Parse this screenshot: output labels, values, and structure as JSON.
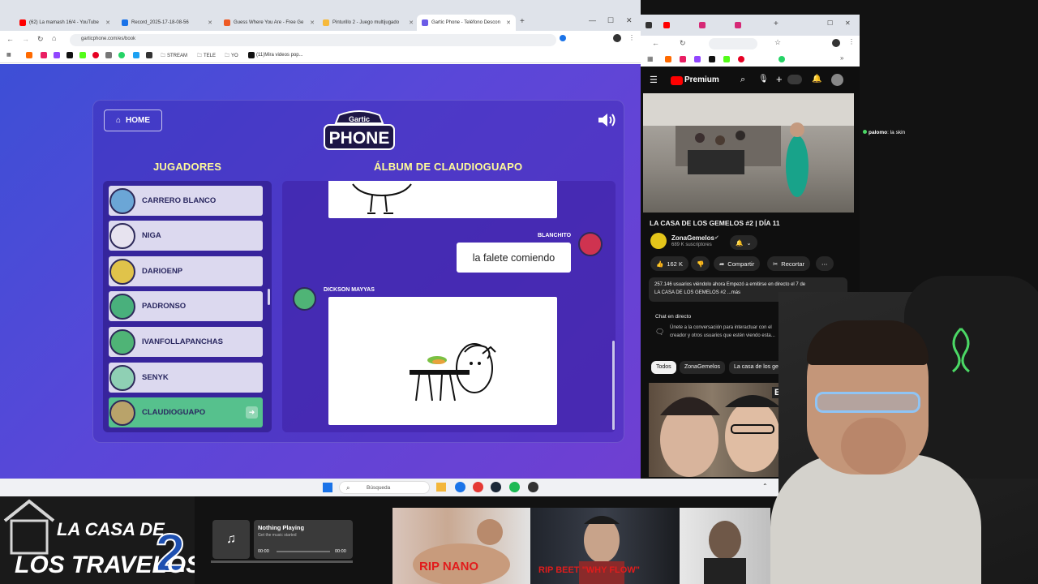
{
  "left_browser": {
    "tabs": [
      {
        "label": "(62) La mamash 16/4 - YouTube",
        "color": "#ff0000"
      },
      {
        "label": "Record_2025-17-18-08-56",
        "color": "#1a73e8"
      },
      {
        "label": "Guess Where You Are - Free Ge",
        "color": "#ee5a24"
      },
      {
        "label": "Pinturillo 2 - Juego multijugado",
        "color": "#f6b93b"
      },
      {
        "label": "Gartic Phone - Teléfono Descon",
        "color": "#6c5ce7"
      }
    ],
    "url": "garticphone.com/es/book",
    "bookmarks": [
      "STREAM",
      "TELE",
      "YO",
      "(11)Mira videos pop..."
    ]
  },
  "game": {
    "home_label": "HOME",
    "logo_top": "Gartic",
    "logo_bottom": "PHONE",
    "players_title": "JUGADORES",
    "album_title": "ÁLBUM DE CLAUDIOGUAPO",
    "players": [
      {
        "name": "CARRERO BLANCO",
        "color": "#6ba6d6"
      },
      {
        "name": "NIGA",
        "color": "#e7e3ef"
      },
      {
        "name": "DARIOENP",
        "color": "#e0c34a"
      },
      {
        "name": "PADRONSO",
        "color": "#49b07c"
      },
      {
        "name": "IVANFOLLAPANCHAS",
        "color": "#4fb476"
      },
      {
        "name": "SENYK",
        "color": "#8fd0b4"
      },
      {
        "name": "CLAUDIOGUAPO",
        "color": "#b9a36a"
      }
    ],
    "album": {
      "author1": "BLANCHITO",
      "phrase": "la falete comiendo",
      "author2": "DICKSON MAYYAS"
    }
  },
  "taskbar": {
    "search_placeholder": "Búsqueda"
  },
  "youtube": {
    "brand": "Premium",
    "video_title": "LA CASA DE LOS GEMELOS #2 | DÍA 11",
    "channel": "ZonaGemelos",
    "subscribers": "689 K suscriptores",
    "likes": "162 K",
    "share": "Compartir",
    "clip": "Recortar",
    "description_line1": "257.146 usuarios viéndolo ahora  Empezó a emitirse en directo el 7 de",
    "description_line2": "LA CASA DE LOS GEMELOS #2 ...más",
    "chat_title": "Chat en directo",
    "chat_line1": "Únete a la conversación para interactuar con el",
    "chat_line2": "creador y otros usuarios que estén viendo esta...",
    "filters": [
      "Todos",
      "ZonaGemelos",
      "La casa de los gemelo"
    ],
    "thumb_caption": "ESTO"
  },
  "overlay": {
    "chat_user": "palomo",
    "chat_message": ": la skin",
    "logo_line1": "LA CASA DE",
    "logo_line2": "LOS TRAVELOS",
    "logo_number": "2",
    "music_title": "Nothing Playing",
    "music_sub": "Get the music started",
    "time_start": "00:00",
    "time_end": "00:00",
    "rip1": "RIP NANO",
    "rip2": "RIP BEET \"WHY FLOW\""
  }
}
